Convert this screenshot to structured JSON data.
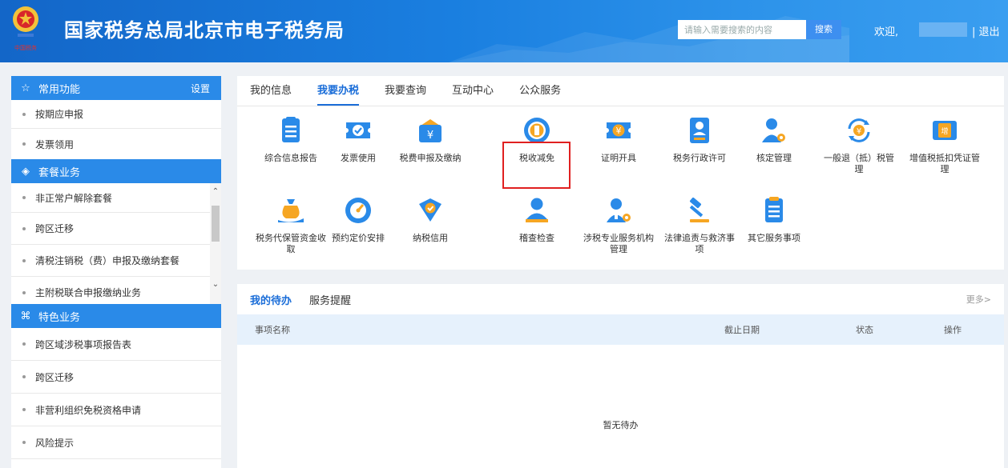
{
  "header": {
    "title": "国家税务总局北京市电子税务局",
    "search_placeholder": "请输入需要搜索的内容",
    "search_button": "搜索",
    "welcome": "欢迎,",
    "logout": "| 退出"
  },
  "sidebar": {
    "common": {
      "title": "常用功能",
      "settings": "设置",
      "icon": "star-icon",
      "items": [
        "按期应申报",
        "发票领用"
      ]
    },
    "package": {
      "title": "套餐业务",
      "icon": "layers-icon",
      "items": [
        "非正常户解除套餐",
        "跨区迁移",
        "清税注销税（费）申报及缴纳套餐",
        "主附税联合申报缴纳业务"
      ]
    },
    "special": {
      "title": "特色业务",
      "icon": "grid-icon",
      "items": [
        "跨区域涉税事项报告表",
        "跨区迁移",
        "非营利组织免税资格申请",
        "风险提示"
      ]
    }
  },
  "main": {
    "tabs": [
      "我的信息",
      "我要办税",
      "我要查询",
      "互动中心",
      "公众服务"
    ],
    "active_tab": "我要办税",
    "services_row1": [
      {
        "label": "综合信息报告",
        "icon": "document-icon"
      },
      {
        "label": "发票使用",
        "icon": "invoice-check-icon"
      },
      {
        "label": "税费申报及缴纳",
        "icon": "yuan-envelope-icon"
      },
      {
        "label": "税收减免",
        "icon": "coin-icon"
      },
      {
        "label": "证明开具",
        "icon": "yuan-ticket-icon"
      },
      {
        "label": "税务行政许可",
        "icon": "id-card-icon"
      },
      {
        "label": "核定管理",
        "icon": "user-gear-icon"
      },
      {
        "label": "一般退（抵）税管理",
        "icon": "yuan-refresh-icon"
      },
      {
        "label": "增值税抵扣凭证管理",
        "icon": "vat-ticket-icon"
      }
    ],
    "services_row2": [
      {
        "label": "税务代保管资金收取",
        "icon": "money-bag-icon"
      },
      {
        "label": "预约定价安排",
        "icon": "gauge-icon"
      },
      {
        "label": "纳税信用",
        "icon": "shield-check-icon"
      },
      {
        "label": "稽查检查",
        "icon": "inspector-icon"
      },
      {
        "label": "涉税专业服务机构管理",
        "icon": "user-settings-icon"
      },
      {
        "label": "法律追责与救济事项",
        "icon": "gavel-icon"
      },
      {
        "label": "其它服务事项",
        "icon": "list-icon"
      }
    ],
    "highlighted": "税收减免"
  },
  "todo": {
    "tabs": [
      "我的待办",
      "服务提醒"
    ],
    "more": "更多>",
    "columns": [
      "事项名称",
      "截止日期",
      "状态",
      "操作"
    ],
    "empty": "暂无待办"
  },
  "colors": {
    "primary": "#1a7fe0",
    "accent": "#2a8ae8",
    "highlight_border": "#e02020"
  }
}
